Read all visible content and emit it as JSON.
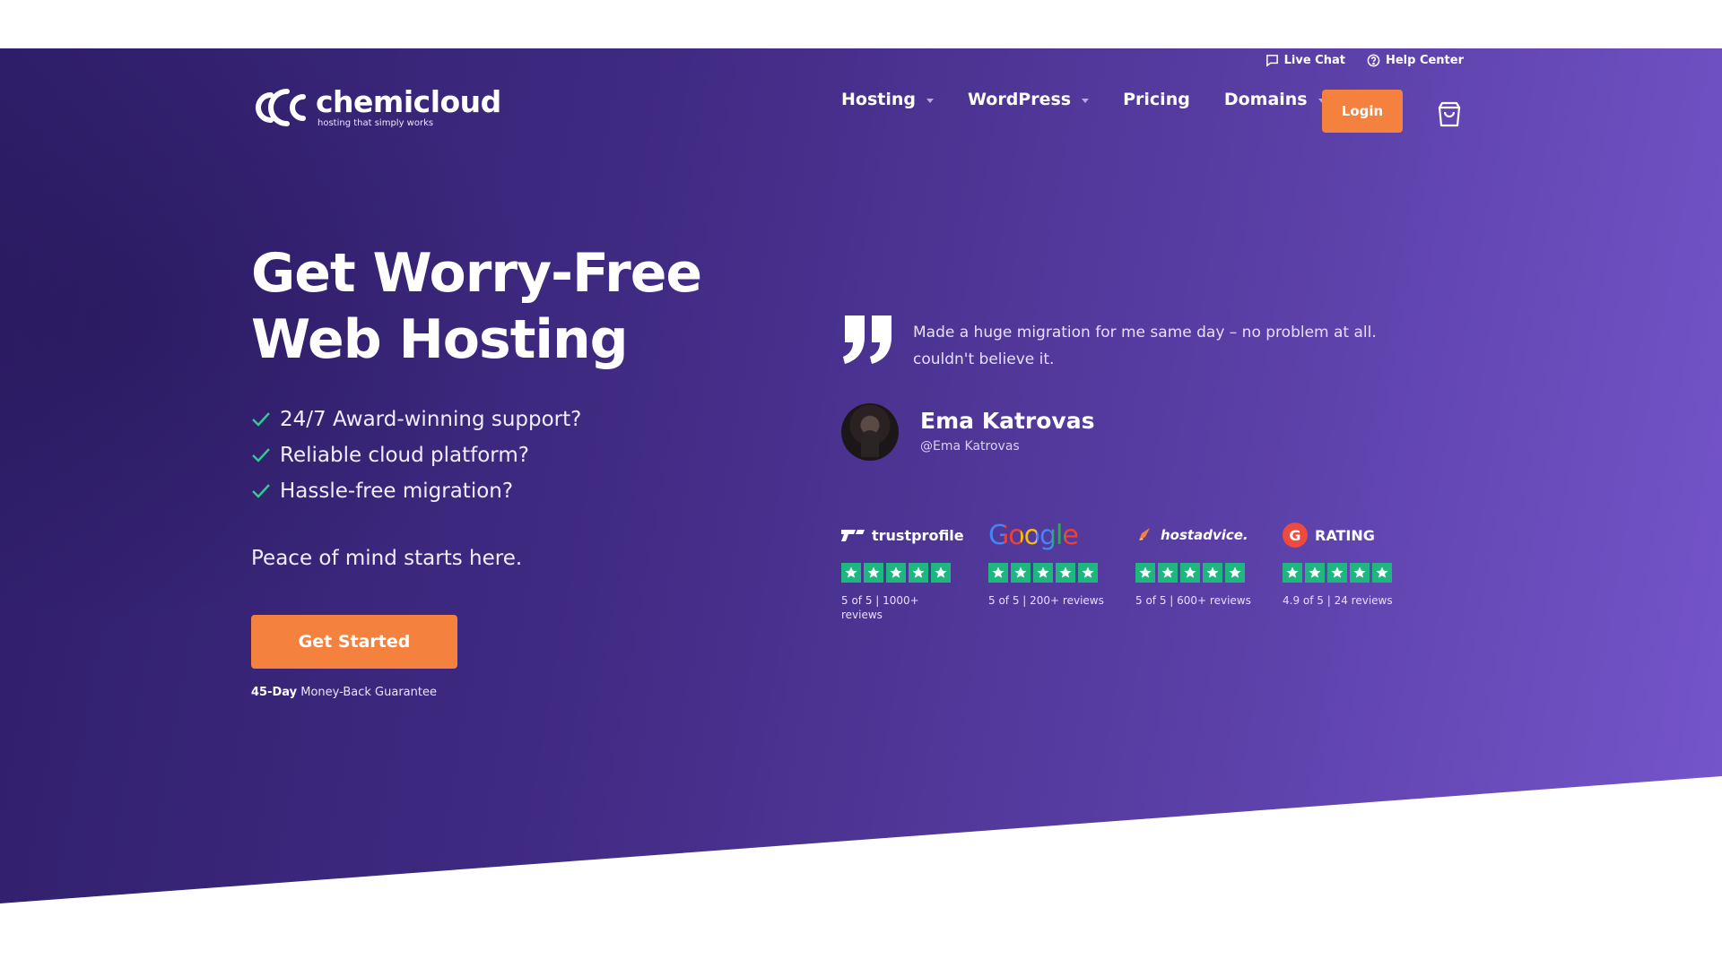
{
  "utility": {
    "live_chat": "Live Chat",
    "help_center": "Help Center"
  },
  "logo": {
    "name": "chemicloud",
    "tagline": "hosting that simply works"
  },
  "nav": {
    "items": [
      {
        "label": "Hosting",
        "has_dropdown": true
      },
      {
        "label": "WordPress",
        "has_dropdown": true
      },
      {
        "label": "Pricing",
        "has_dropdown": false
      },
      {
        "label": "Domains",
        "has_dropdown": true
      }
    ],
    "login": "Login",
    "cart_icon": "shopping-bag-icon"
  },
  "hero": {
    "headline": "Get Worry-Free Web Hosting",
    "features": [
      "24/7 Award-winning support?",
      "Reliable cloud platform?",
      "Hassle-free migration?"
    ],
    "tagline": "Peace of mind starts here.",
    "cta": "Get Started",
    "guarantee_bold": "45-Day",
    "guarantee_rest": " Money-Back Guarantee"
  },
  "testimonial": {
    "quote": "Made a huge migration for me same day – no problem at all. couldn't believe it.",
    "name": "Ema Katrovas",
    "handle": "@Ema Katrovas"
  },
  "ratings": [
    {
      "source": "trustprofile",
      "stars": 5,
      "text": "5 of 5 | 1000+ reviews"
    },
    {
      "source": "Google",
      "stars": 5,
      "text": "5 of 5 | 200+ reviews"
    },
    {
      "source": "hostadvice.",
      "stars": 5,
      "text": "5 of 5 | 600+ reviews"
    },
    {
      "source": "RATING",
      "stars": 5,
      "text": "4.9 of 5 | 24 reviews"
    }
  ],
  "colors": {
    "accent": "#f5813f",
    "star_green": "#1fb67f",
    "hero_start": "#2f1e6a",
    "hero_end": "#7656cc"
  }
}
